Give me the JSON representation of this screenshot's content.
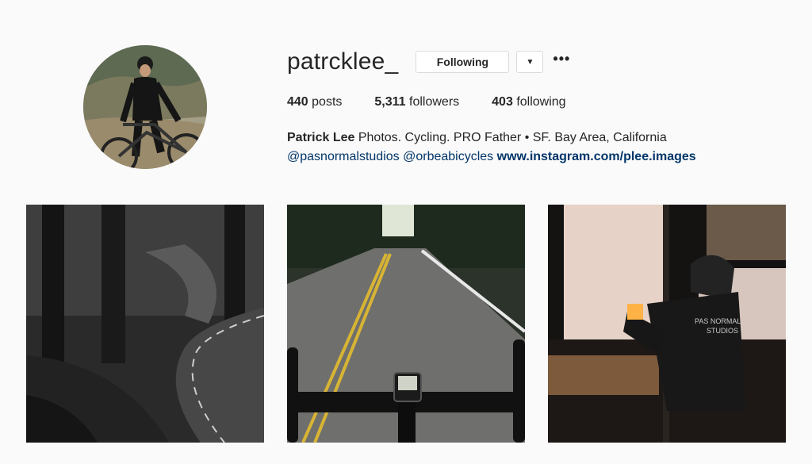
{
  "profile": {
    "username": "patrcklee_",
    "follow_button": "Following",
    "dropdown_icon": "chevron-down-icon",
    "more_icon": "more-options-icon",
    "more_glyph": "•••"
  },
  "stats": {
    "posts_count": "440",
    "posts_label": "posts",
    "followers_count": "5,311",
    "followers_label": "followers",
    "following_count": "403",
    "following_label": "following"
  },
  "bio": {
    "full_name": "Patrick Lee",
    "text": "Photos. Cycling. PRO Father • SF. Bay Area, California",
    "mention_1": "@pasnormalstudios",
    "mention_2": "@orbeabicycles",
    "website": "www.instagram.com/plee.images"
  },
  "posts": [
    {
      "description": "black and white forest road"
    },
    {
      "description": "road with bicycle handlebars"
    },
    {
      "description": "cyclist drinking coffee by window",
      "jersey_text_1": "PAS NORMAL",
      "jersey_text_2": "STUDIOS"
    }
  ],
  "colors": {
    "text": "#262626",
    "link": "#003569",
    "border": "#dbdbdb",
    "background": "#fafafa"
  }
}
